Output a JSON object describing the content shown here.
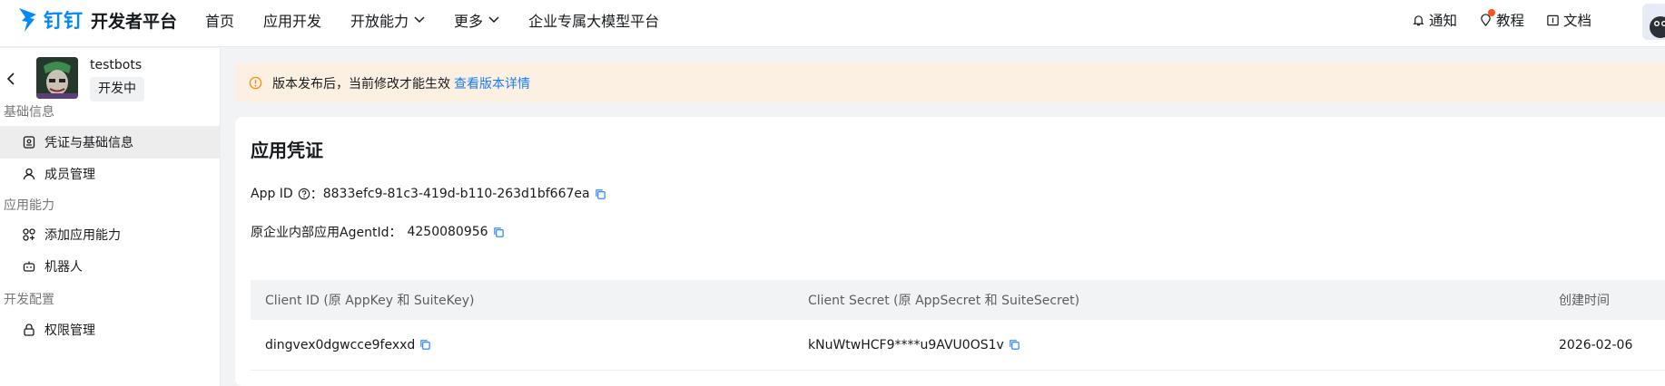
{
  "header": {
    "brand": "钉钉",
    "platform": "开发者平台",
    "nav": [
      {
        "label": "首页"
      },
      {
        "label": "应用开发"
      },
      {
        "label": "开放能力",
        "dropdown": true
      },
      {
        "label": "更多",
        "dropdown": true
      },
      {
        "label": "企业专属大模型平台"
      }
    ],
    "tools": {
      "notify": "通知",
      "tutorial": "教程",
      "docs": "文档"
    },
    "accent_color": "#0089ff",
    "badge_color": "#ff5219"
  },
  "sidebar": {
    "app": {
      "name": "testbots",
      "status": "开发中"
    },
    "sections": [
      {
        "title": "基础信息",
        "items": [
          {
            "label": "凭证与基础信息",
            "icon": "credential-icon",
            "active": true
          },
          {
            "label": "成员管理",
            "icon": "user-icon",
            "active": false
          }
        ]
      },
      {
        "title": "应用能力",
        "items": [
          {
            "label": "添加应用能力",
            "icon": "apps-icon",
            "active": false
          },
          {
            "label": "机器人",
            "icon": "robot-icon",
            "active": false
          }
        ]
      },
      {
        "title": "开发配置",
        "items": [
          {
            "label": "权限管理",
            "icon": "lock-icon",
            "active": false
          }
        ]
      }
    ]
  },
  "notice": {
    "text": "版本发布后，当前修改才能生效",
    "link": "查看版本详情",
    "background": "#fbf0e2",
    "icon_color": "#ff8800"
  },
  "credentials": {
    "title": "应用凭证",
    "app_id_label": "App ID",
    "app_id_sep": "：",
    "app_id": "8833efc9-81c3-419d-b110-263d1bf667ea",
    "agent_label": "原企业内部应用AgentId：",
    "agent_id": "4250080956",
    "table": {
      "columns": [
        "Client ID (原 AppKey 和 SuiteKey)",
        "Client Secret (原 AppSecret 和 SuiteSecret)",
        "创建时间"
      ],
      "rows": [
        {
          "client_id": "dingvex0dgwcce9fexxd",
          "client_secret": "kNuWtwHCF9****u9AVU0OS1v",
          "created": "2026-02-06"
        }
      ]
    }
  }
}
